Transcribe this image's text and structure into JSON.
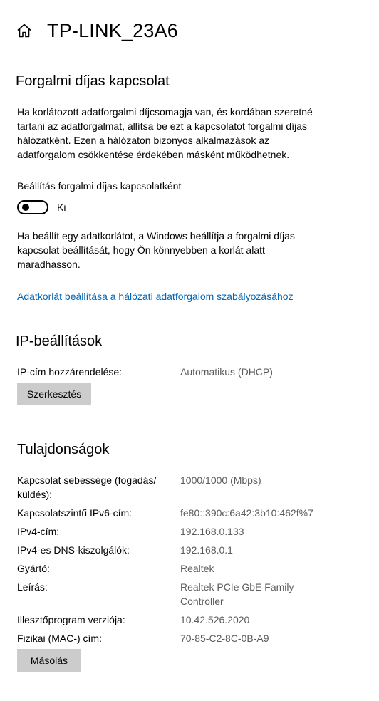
{
  "header": {
    "home_icon": "home-icon",
    "title": "TP-LINK_23A6"
  },
  "metered": {
    "title": "Forgalmi díjas kapcsolat",
    "description_lines": [
      "Ha korlátozott adatforgalmi díjcsomagja van, és kordában szeretné",
      "tartani az adatforgalmat, állítsa be ezt a kapcsolatot forgalmi díjas",
      "hálózatként. Ezen a hálózaton bizonyos alkalmazások az",
      "adatforgalom csökkentése érdekében másként működhetnek."
    ],
    "toggle_label": "Beállítás forgalmi díjas kapcsolatként",
    "toggle_state": "Ki",
    "toggle_on": false,
    "info_lines": [
      "Ha beállít egy adatkorlátot, a Windows beállítja a forgalmi díjas",
      "kapcsolat beállítását, hogy Ön könnyebben a korlát alatt",
      "maradhasson."
    ],
    "data_limit_link": "Adatkorlát beállítása a hálózati adatforgalom szabályozásához"
  },
  "ip_settings": {
    "title": "IP-beállítások",
    "assignment_label": "IP-cím hozzárendelése:",
    "assignment_value": "Automatikus (DHCP)",
    "edit_button": "Szerkesztés"
  },
  "properties": {
    "title": "Tulajdonságok",
    "rows": [
      {
        "label_lines": [
          "Kapcsolat sebessége (fogadás/",
          "küldés):"
        ],
        "value_lines": [
          "1000/1000 (Mbps)"
        ]
      },
      {
        "label_lines": [
          "Kapcsolatszintű IPv6-cím:"
        ],
        "value_lines": [
          "fe80::390c:6a42:3b10:462f%7"
        ]
      },
      {
        "label_lines": [
          "IPv4-cím:"
        ],
        "value_lines": [
          "192.168.0.133"
        ]
      },
      {
        "label_lines": [
          "IPv4-es DNS-kiszolgálók:"
        ],
        "value_lines": [
          "192.168.0.1"
        ]
      },
      {
        "label_lines": [
          "Gyártó:"
        ],
        "value_lines": [
          "Realtek"
        ]
      },
      {
        "label_lines": [
          "Leírás:"
        ],
        "value_lines": [
          "Realtek PCIe GbE Family",
          "Controller"
        ]
      },
      {
        "label_lines": [
          "Illesztőprogram verziója:"
        ],
        "value_lines": [
          "10.42.526.2020"
        ]
      },
      {
        "label_lines": [
          "Fizikai (MAC-) cím:"
        ],
        "value_lines": [
          "70-85-C2-8C-0B-A9"
        ]
      }
    ],
    "copy_button": "Másolás"
  },
  "colors": {
    "link": "#0067b8",
    "secondary_text": "#5c5c5c",
    "button_bg": "#cccccc"
  }
}
